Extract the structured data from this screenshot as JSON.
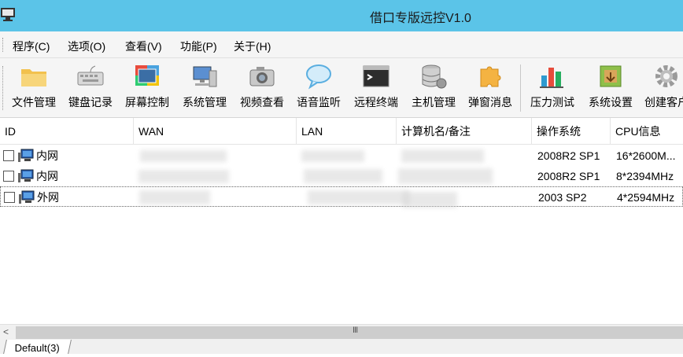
{
  "window": {
    "title": "借口专版远控V1.0"
  },
  "menu": [
    "程序(C)",
    "选项(O)",
    "查看(V)",
    "功能(P)",
    "关于(H)"
  ],
  "toolbar": [
    {
      "label": "文件管理",
      "icon": "folder-icon"
    },
    {
      "label": "键盘记录",
      "icon": "keyboard-icon"
    },
    {
      "label": "屏幕控制",
      "icon": "screen-control-icon"
    },
    {
      "label": "系统管理",
      "icon": "system-manage-icon"
    },
    {
      "label": "视频查看",
      "icon": "camera-icon"
    },
    {
      "label": "语音监听",
      "icon": "speech-bubble-icon"
    },
    {
      "label": "远程终端",
      "icon": "terminal-icon"
    },
    {
      "label": "主机管理",
      "icon": "database-icon"
    },
    {
      "label": "弹窗消息",
      "icon": "puzzle-icon"
    },
    {
      "label": "压力测试",
      "icon": "bar-chart-icon"
    },
    {
      "label": "系统设置",
      "icon": "settings-box-icon"
    },
    {
      "label": "创建客户",
      "icon": "gear-icon"
    }
  ],
  "columns": [
    "ID",
    "WAN",
    "LAN",
    "计算机名/备注",
    "操作系统",
    "CPU信息"
  ],
  "rows": [
    {
      "id": "内网",
      "wan": "",
      "lan": "",
      "name": "",
      "os": "2008R2 SP1",
      "cpu": "16*2600M..."
    },
    {
      "id": "内网",
      "wan": "",
      "lan": "",
      "name": "",
      "os": "2008R2 SP1",
      "cpu": "8*2394MHz"
    },
    {
      "id": "外网",
      "wan": "",
      "lan": "",
      "name": "",
      "os": "2003 SP2",
      "cpu": "4*2594MHz"
    }
  ],
  "scrollbar": {
    "left_arrow": "<",
    "grip": "III"
  },
  "tabs": [
    "Default(3)"
  ]
}
